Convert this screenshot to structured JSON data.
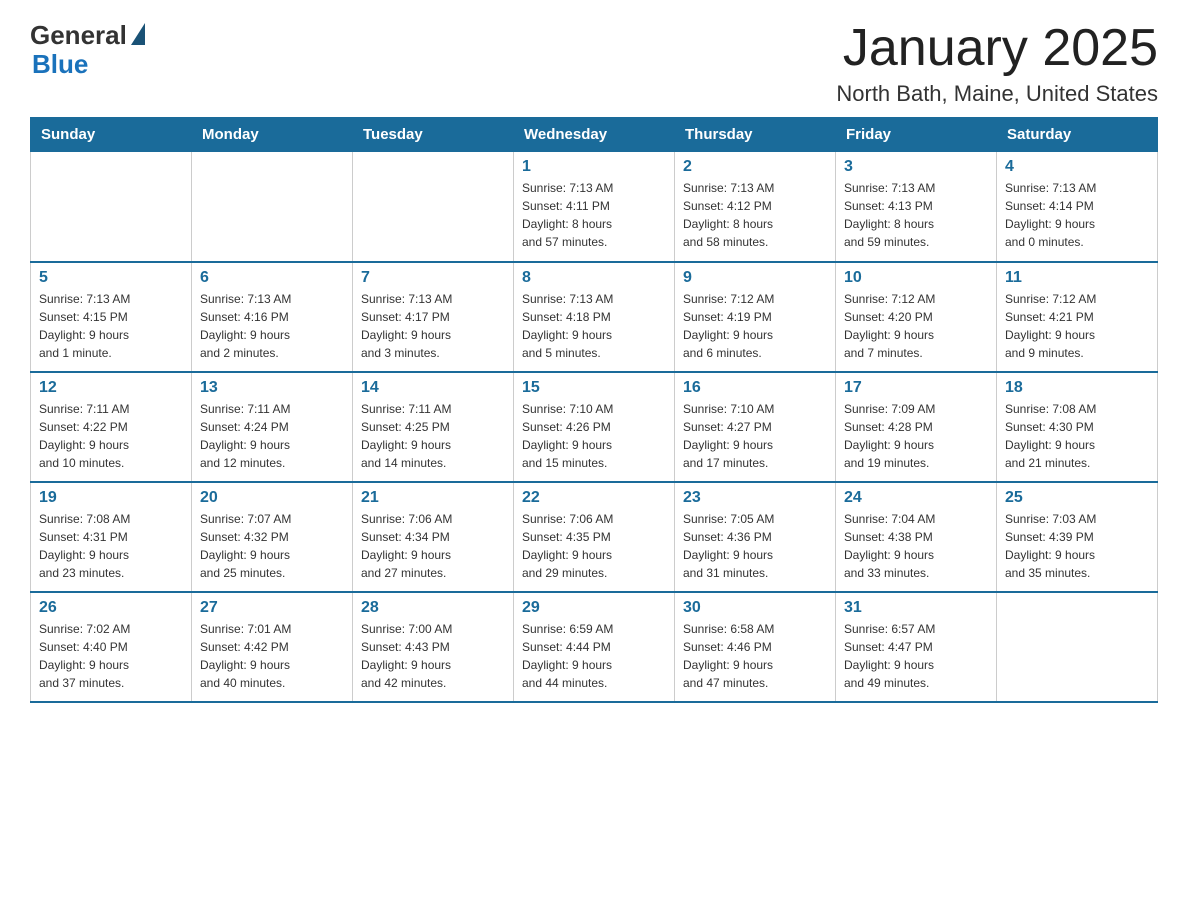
{
  "logo": {
    "general": "General",
    "blue": "Blue"
  },
  "title": "January 2025",
  "subtitle": "North Bath, Maine, United States",
  "days_of_week": [
    "Sunday",
    "Monday",
    "Tuesday",
    "Wednesday",
    "Thursday",
    "Friday",
    "Saturday"
  ],
  "weeks": [
    [
      {
        "day": "",
        "info": ""
      },
      {
        "day": "",
        "info": ""
      },
      {
        "day": "",
        "info": ""
      },
      {
        "day": "1",
        "info": "Sunrise: 7:13 AM\nSunset: 4:11 PM\nDaylight: 8 hours\nand 57 minutes."
      },
      {
        "day": "2",
        "info": "Sunrise: 7:13 AM\nSunset: 4:12 PM\nDaylight: 8 hours\nand 58 minutes."
      },
      {
        "day": "3",
        "info": "Sunrise: 7:13 AM\nSunset: 4:13 PM\nDaylight: 8 hours\nand 59 minutes."
      },
      {
        "day": "4",
        "info": "Sunrise: 7:13 AM\nSunset: 4:14 PM\nDaylight: 9 hours\nand 0 minutes."
      }
    ],
    [
      {
        "day": "5",
        "info": "Sunrise: 7:13 AM\nSunset: 4:15 PM\nDaylight: 9 hours\nand 1 minute."
      },
      {
        "day": "6",
        "info": "Sunrise: 7:13 AM\nSunset: 4:16 PM\nDaylight: 9 hours\nand 2 minutes."
      },
      {
        "day": "7",
        "info": "Sunrise: 7:13 AM\nSunset: 4:17 PM\nDaylight: 9 hours\nand 3 minutes."
      },
      {
        "day": "8",
        "info": "Sunrise: 7:13 AM\nSunset: 4:18 PM\nDaylight: 9 hours\nand 5 minutes."
      },
      {
        "day": "9",
        "info": "Sunrise: 7:12 AM\nSunset: 4:19 PM\nDaylight: 9 hours\nand 6 minutes."
      },
      {
        "day": "10",
        "info": "Sunrise: 7:12 AM\nSunset: 4:20 PM\nDaylight: 9 hours\nand 7 minutes."
      },
      {
        "day": "11",
        "info": "Sunrise: 7:12 AM\nSunset: 4:21 PM\nDaylight: 9 hours\nand 9 minutes."
      }
    ],
    [
      {
        "day": "12",
        "info": "Sunrise: 7:11 AM\nSunset: 4:22 PM\nDaylight: 9 hours\nand 10 minutes."
      },
      {
        "day": "13",
        "info": "Sunrise: 7:11 AM\nSunset: 4:24 PM\nDaylight: 9 hours\nand 12 minutes."
      },
      {
        "day": "14",
        "info": "Sunrise: 7:11 AM\nSunset: 4:25 PM\nDaylight: 9 hours\nand 14 minutes."
      },
      {
        "day": "15",
        "info": "Sunrise: 7:10 AM\nSunset: 4:26 PM\nDaylight: 9 hours\nand 15 minutes."
      },
      {
        "day": "16",
        "info": "Sunrise: 7:10 AM\nSunset: 4:27 PM\nDaylight: 9 hours\nand 17 minutes."
      },
      {
        "day": "17",
        "info": "Sunrise: 7:09 AM\nSunset: 4:28 PM\nDaylight: 9 hours\nand 19 minutes."
      },
      {
        "day": "18",
        "info": "Sunrise: 7:08 AM\nSunset: 4:30 PM\nDaylight: 9 hours\nand 21 minutes."
      }
    ],
    [
      {
        "day": "19",
        "info": "Sunrise: 7:08 AM\nSunset: 4:31 PM\nDaylight: 9 hours\nand 23 minutes."
      },
      {
        "day": "20",
        "info": "Sunrise: 7:07 AM\nSunset: 4:32 PM\nDaylight: 9 hours\nand 25 minutes."
      },
      {
        "day": "21",
        "info": "Sunrise: 7:06 AM\nSunset: 4:34 PM\nDaylight: 9 hours\nand 27 minutes."
      },
      {
        "day": "22",
        "info": "Sunrise: 7:06 AM\nSunset: 4:35 PM\nDaylight: 9 hours\nand 29 minutes."
      },
      {
        "day": "23",
        "info": "Sunrise: 7:05 AM\nSunset: 4:36 PM\nDaylight: 9 hours\nand 31 minutes."
      },
      {
        "day": "24",
        "info": "Sunrise: 7:04 AM\nSunset: 4:38 PM\nDaylight: 9 hours\nand 33 minutes."
      },
      {
        "day": "25",
        "info": "Sunrise: 7:03 AM\nSunset: 4:39 PM\nDaylight: 9 hours\nand 35 minutes."
      }
    ],
    [
      {
        "day": "26",
        "info": "Sunrise: 7:02 AM\nSunset: 4:40 PM\nDaylight: 9 hours\nand 37 minutes."
      },
      {
        "day": "27",
        "info": "Sunrise: 7:01 AM\nSunset: 4:42 PM\nDaylight: 9 hours\nand 40 minutes."
      },
      {
        "day": "28",
        "info": "Sunrise: 7:00 AM\nSunset: 4:43 PM\nDaylight: 9 hours\nand 42 minutes."
      },
      {
        "day": "29",
        "info": "Sunrise: 6:59 AM\nSunset: 4:44 PM\nDaylight: 9 hours\nand 44 minutes."
      },
      {
        "day": "30",
        "info": "Sunrise: 6:58 AM\nSunset: 4:46 PM\nDaylight: 9 hours\nand 47 minutes."
      },
      {
        "day": "31",
        "info": "Sunrise: 6:57 AM\nSunset: 4:47 PM\nDaylight: 9 hours\nand 49 minutes."
      },
      {
        "day": "",
        "info": ""
      }
    ]
  ]
}
